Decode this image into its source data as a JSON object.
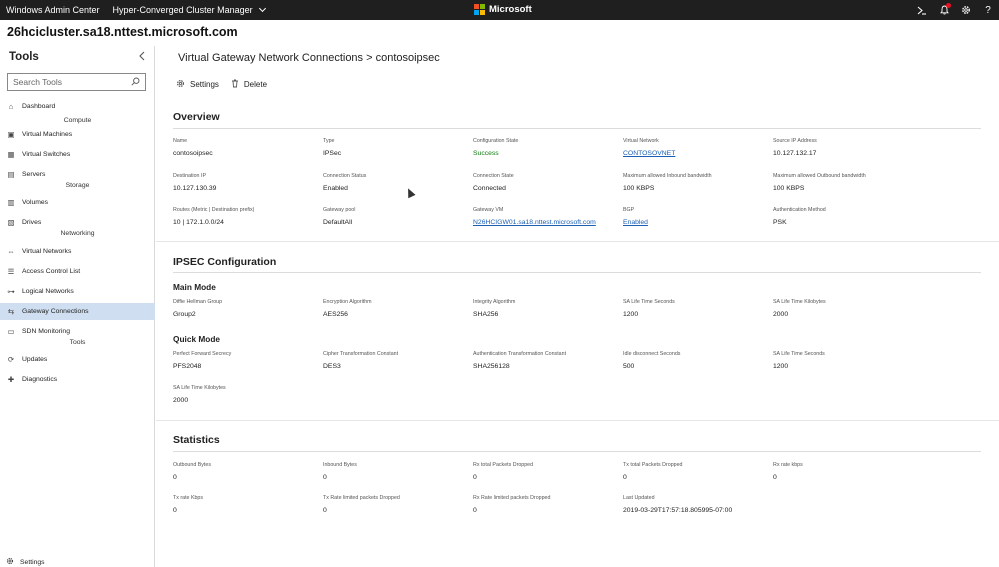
{
  "topbar": {
    "app_title": "Windows Admin Center",
    "context": "Hyper-Converged Cluster Manager",
    "brand": "Microsoft",
    "logo_colors": [
      "#f25022",
      "#7fba00",
      "#00a4ef",
      "#ffb900"
    ]
  },
  "header": {
    "server_name": "26hcicluster.sa18.nttest.microsoft.com"
  },
  "sidebar": {
    "title": "Tools",
    "search_placeholder": "Search Tools",
    "items": [
      {
        "label": "Dashboard",
        "icon": "home-icon"
      },
      {
        "section": "Compute"
      },
      {
        "label": "Virtual Machines",
        "icon": "vm-icon"
      },
      {
        "label": "Virtual Switches",
        "icon": "switch-icon"
      },
      {
        "label": "Servers",
        "icon": "server-icon"
      },
      {
        "section": "Storage"
      },
      {
        "label": "Volumes",
        "icon": "volume-icon"
      },
      {
        "label": "Drives",
        "icon": "drive-icon"
      },
      {
        "section": "Networking"
      },
      {
        "label": "Virtual Networks",
        "icon": "network-icon"
      },
      {
        "label": "Access Control List",
        "icon": "list-icon"
      },
      {
        "label": "Logical Networks",
        "icon": "logical-network-icon"
      },
      {
        "label": "Gateway Connections",
        "icon": "gateway-icon",
        "active": true
      },
      {
        "label": "SDN Monitoring",
        "icon": "monitor-icon"
      },
      {
        "section": "Tools"
      },
      {
        "label": "Updates",
        "icon": "updates-icon"
      },
      {
        "label": "Diagnostics",
        "icon": "diagnostics-icon"
      }
    ],
    "settings_label": "Settings"
  },
  "main": {
    "title": "Virtual Gateway Network Connections > contosoipsec",
    "toolbar": {
      "settings": "Settings",
      "delete": "Delete"
    },
    "overview": {
      "title": "Overview",
      "fields": [
        {
          "label": "Name",
          "value": "contosoipsec"
        },
        {
          "label": "Type",
          "value": "IPSec"
        },
        {
          "label": "Configuration State",
          "value": "Success",
          "style": "success"
        },
        {
          "label": "Virtual Network",
          "value": "CONTOSOVNET",
          "style": "link"
        },
        {
          "label": "Source IP Address",
          "value": "10.127.132.17"
        },
        {
          "label": "Destination IP",
          "value": "10.127.130.39"
        },
        {
          "label": "Connection Status",
          "value": "Enabled"
        },
        {
          "label": "Connection State",
          "value": "Connected"
        },
        {
          "label": "Maximum allowed Inbound bandwidth",
          "value": "100 KBPS"
        },
        {
          "label": "Maximum allowed Outbound bandwidth",
          "value": "100 KBPS"
        },
        {
          "label": "Routes (Metric | Destination prefix)",
          "value": "10 | 172.1.0.0/24"
        },
        {
          "label": "Gateway pool",
          "value": "DefaultAll"
        },
        {
          "label": "Gateway VM",
          "value": "N26HCIGW01.sa18.nttest.microsoft.com",
          "style": "link"
        },
        {
          "label": "BGP",
          "value": "Enabled",
          "style": "link"
        },
        {
          "label": "Authentication Method",
          "value": "PSK"
        }
      ]
    },
    "ipsec": {
      "title": "IPSEC Configuration",
      "main_mode": {
        "title": "Main Mode",
        "fields": [
          {
            "label": "Diffie Hellman Group",
            "value": "Group2"
          },
          {
            "label": "Encryption Algorithm",
            "value": "AES256"
          },
          {
            "label": "Integrity Algorithm",
            "value": "SHA256"
          },
          {
            "label": "SA Life Time Seconds",
            "value": "1200"
          },
          {
            "label": "SA Life Time Kilobytes",
            "value": "2000"
          }
        ]
      },
      "quick_mode": {
        "title": "Quick Mode",
        "fields": [
          {
            "label": "Perfect Forward Secrecy",
            "value": "PFS2048"
          },
          {
            "label": "Cipher Transformation Constant",
            "value": "DES3"
          },
          {
            "label": "Authentication Transformation Constant",
            "value": "SHA256128"
          },
          {
            "label": "Idle disconnect Seconds",
            "value": "500"
          },
          {
            "label": "SA Life Time Seconds",
            "value": "1200"
          },
          {
            "label": "SA Life Time Kilobytes",
            "value": "2000"
          }
        ]
      }
    },
    "statistics": {
      "title": "Statistics",
      "fields": [
        {
          "label": "Outbound Bytes",
          "value": "0"
        },
        {
          "label": "Inbound Bytes",
          "value": "0"
        },
        {
          "label": "Rx total Packets Dropped",
          "value": "0"
        },
        {
          "label": "Tx total Packets Dropped",
          "value": "0"
        },
        {
          "label": "Rx rate kbps",
          "value": "0"
        },
        {
          "label": "Tx rate Kbps",
          "value": "0"
        },
        {
          "label": "Tx Rate limited packets Dropped",
          "value": "0"
        },
        {
          "label": "Rx Rate limited packets Dropped",
          "value": "0"
        },
        {
          "label": "Last Updated",
          "value": "2019-03-29T17:57:18.805995-07:00"
        }
      ]
    }
  }
}
